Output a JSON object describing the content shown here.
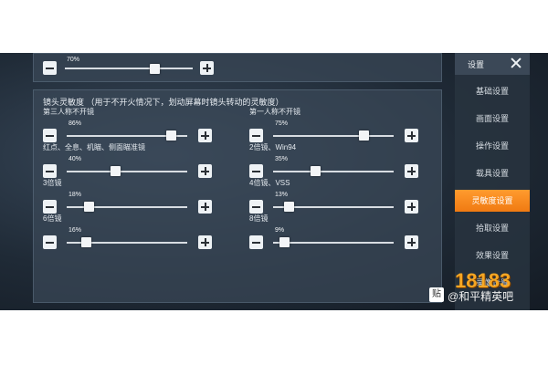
{
  "settings": {
    "header": "设置",
    "menu": [
      "基础设置",
      "画面设置",
      "操作设置",
      "载具设置",
      "灵敏度设置",
      "拾取设置",
      "效果设置",
      "录像设置"
    ],
    "active_index": 4,
    "top_slider": {
      "value": 70
    },
    "section": {
      "title": "镜头灵敏度 （用于不开火情况下，划动屏幕时镜头转动的灵敏度）",
      "sliders": [
        {
          "label": "第三人称不开镜",
          "value": 86
        },
        {
          "label": "第一人称不开镜",
          "value": 75
        },
        {
          "label": "红点、全息、机瞄、侧面瞄准镜",
          "value": 40
        },
        {
          "label": "2倍镜、Win94",
          "value": 35
        },
        {
          "label": "3倍镜",
          "value": 18
        },
        {
          "label": "4倍镜、VSS",
          "value": 13
        },
        {
          "label": "6倍镜",
          "value": 16
        },
        {
          "label": "8倍镜",
          "value": 9
        }
      ]
    }
  },
  "watermark": {
    "logo": "18183",
    "caption": "@和平精英吧",
    "badge": "贴"
  },
  "colors": {
    "accent": "#f07a12",
    "panel": "#3a4858"
  }
}
